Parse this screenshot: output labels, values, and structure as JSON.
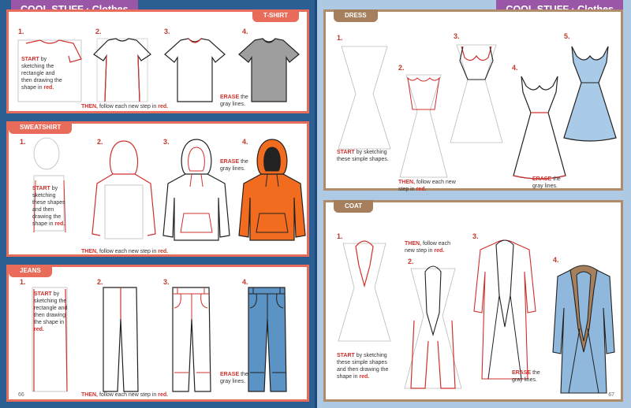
{
  "left_page": {
    "header": "COOL STUFF · Clothes",
    "page_number": "66",
    "tshirt": {
      "tab": "T-SHIRT",
      "steps": [
        "1.",
        "2.",
        "3.",
        "4."
      ],
      "start_word": "START",
      "start_text": " by sketching the rectangle and then drawing the shape in ",
      "red_word": "red.",
      "then_word": "THEN,",
      "then_text": " follow each new step in ",
      "then_red": "red.",
      "erase_word": "ERASE",
      "erase_text": " the gray lines."
    },
    "sweatshirt": {
      "tab": "SWEATSHIRT",
      "steps": [
        "1.",
        "2.",
        "3.",
        "4."
      ],
      "start_word": "START",
      "start_text": " by sketching these shapes and then drawing the shape in ",
      "red_word": "red.",
      "then_word": "THEN,",
      "then_text": " follow each new step in ",
      "then_red": "red.",
      "erase_word": "ERASE",
      "erase_text": " the gray lines."
    },
    "jeans": {
      "tab": "JEANS",
      "steps": [
        "1.",
        "2.",
        "3.",
        "4."
      ],
      "start_word": "START",
      "start_text": " by sketching the rectangle and then drawing the shape in ",
      "red_word": "red.",
      "then_word": "THEN,",
      "then_text": " follow each new step in ",
      "then_red": "red.",
      "erase_word": "ERASE",
      "erase_text": " the gray lines."
    }
  },
  "right_page": {
    "header": "COOL STUFF · Clothes",
    "page_number": "67",
    "dress": {
      "tab": "DRESS",
      "steps": [
        "1.",
        "2.",
        "3.",
        "4.",
        "5."
      ],
      "start_word": "START",
      "start_text": " by sketching these simple shapes.",
      "then_word": "THEN,",
      "then_text": " follow each new step in ",
      "then_red": "red.",
      "erase_word": "ERASE",
      "erase_text": " the gray lines."
    },
    "coat": {
      "tab": "COAT",
      "steps": [
        "1.",
        "2.",
        "3.",
        "4."
      ],
      "start_word": "START",
      "start_text": " by sketching these simple shapes and then drawing the shape in ",
      "red_word": "red.",
      "then_word": "THEN,",
      "then_text": " follow each new step in ",
      "then_red": "red.",
      "erase_word": "ERASE",
      "erase_text": " the gray lines."
    }
  },
  "colors": {
    "left_bg": "#2b5f94",
    "right_bg": "#aec9e4",
    "header_purple": "#9a57a8",
    "panel_red": "#e96c5b",
    "panel_brown": "#a67f5d",
    "step_red": "#d0312d",
    "sweatshirt_orange": "#f26c1f",
    "jeans_blue": "#5b93c4",
    "dress_blue": "#aacbe8",
    "coat_blue": "#8fb8dc",
    "coat_collar": "#a67f5d"
  }
}
